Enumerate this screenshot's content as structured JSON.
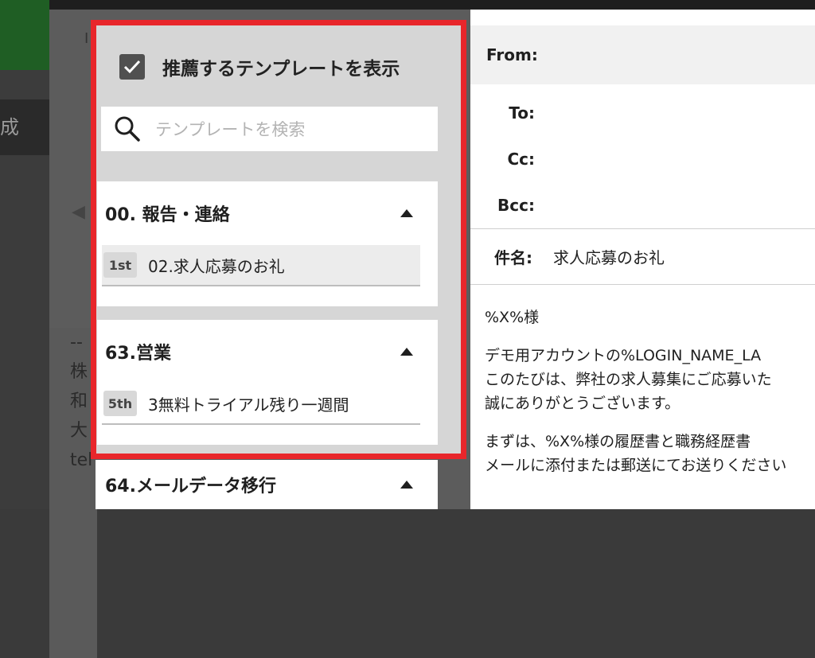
{
  "background": {
    "nav_letter": "成",
    "toolbar_letter": "I",
    "signature_lines": [
      "--",
      "株",
      "和",
      "大",
      "tel"
    ]
  },
  "template_panel": {
    "recommend_checked": true,
    "recommend_label": "推薦するテンプレートを表示",
    "search_placeholder": "テンプレートを検索",
    "groups": [
      {
        "title": "00. 報告・連絡",
        "expanded": true,
        "items": [
          {
            "rank": "1st",
            "label": "02.求人応募のお礼",
            "active": true
          }
        ]
      },
      {
        "title": "63.営業",
        "expanded": true,
        "items": [
          {
            "rank": "5th",
            "label": "3無料トライアル残り一週間",
            "active": false
          }
        ]
      },
      {
        "title": "64.メールデータ移行",
        "expanded": true,
        "items": []
      }
    ],
    "highlight_color": "#e8262b"
  },
  "composer": {
    "from_label": "From:",
    "to_label": "To:",
    "cc_label": "Cc:",
    "bcc_label": "Bcc:",
    "subject_label": "件名:",
    "subject_value": "求人応募のお礼",
    "body_paragraphs": [
      [
        "%X%様"
      ],
      [
        "デモ用アカウントの%LOGIN_NAME_LA",
        "このたびは、弊社の求人募集にご応募いた",
        "誠にありがとうございます。"
      ],
      [
        "まずは、%X%様の履歴書と職務経歴書",
        "メールに添付または郵送にてお送りください"
      ]
    ]
  }
}
